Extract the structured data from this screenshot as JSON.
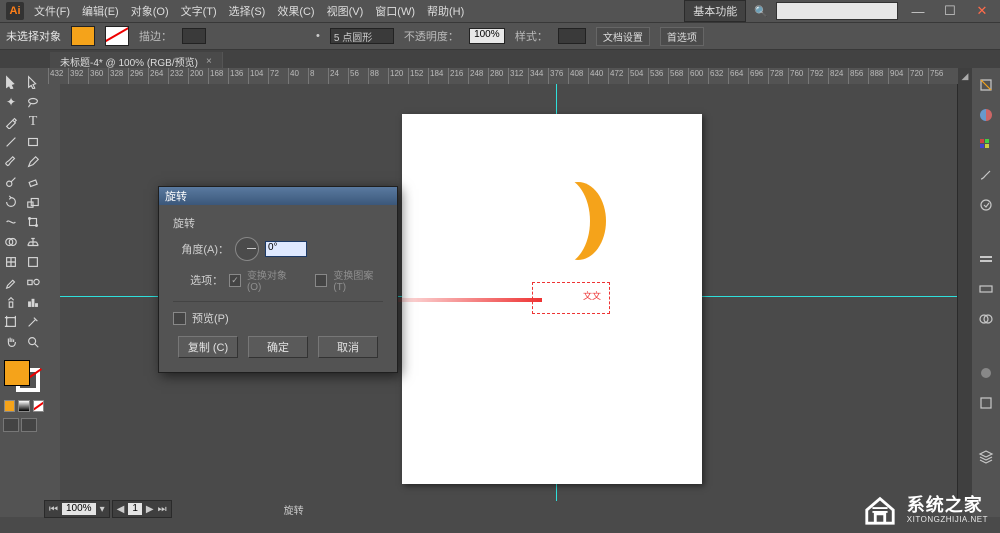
{
  "menubar": {
    "items": [
      "文件(F)",
      "编辑(E)",
      "对象(O)",
      "文字(T)",
      "选择(S)",
      "效果(C)",
      "视图(V)",
      "窗口(W)",
      "帮助(H)"
    ],
    "workspace": "基本功能",
    "search_placeholder": ""
  },
  "controlbar": {
    "no_selection": "未选择对象",
    "stroke_label": "描边：",
    "stroke_pt": "",
    "brush_preset": "5 点圆形",
    "opacity_label": "不透明度：",
    "opacity_value": "100%",
    "style_label": "样式：",
    "doc_setup": "文档设置",
    "prefs": "首选项"
  },
  "doc_tab": {
    "title": "未标题-4* @ 100% (RGB/预览)"
  },
  "ruler_ticks": [
    "432",
    "392",
    "360",
    "328",
    "296",
    "264",
    "232",
    "200",
    "168",
    "136",
    "104",
    "72",
    "40",
    "8",
    "24",
    "56",
    "88",
    "120",
    "152",
    "184",
    "216",
    "248",
    "280",
    "312",
    "344",
    "376",
    "408",
    "440",
    "472",
    "504",
    "536",
    "568",
    "600",
    "632",
    "664",
    "696",
    "728",
    "760",
    "792",
    "824",
    "856",
    "888",
    "904",
    "720",
    "756"
  ],
  "dialog": {
    "title": "旋转",
    "section": "旋转",
    "angle_label": "角度(A)：",
    "angle_value": "0°",
    "options_label": "选项：",
    "transform_objects": "变换对象 (O)",
    "transform_patterns": "变换图案 (T)",
    "preview": "预览(P)",
    "copy_btn": "复制 (C)",
    "ok_btn": "确定",
    "cancel_btn": "取消"
  },
  "canvas": {
    "anchor_label": "文文"
  },
  "statusbar": {
    "zoom": "100%",
    "page": "1",
    "tool": "旋转"
  },
  "watermark": {
    "cn": "系统之家",
    "en": "XITONGZHIJIA.NET"
  }
}
